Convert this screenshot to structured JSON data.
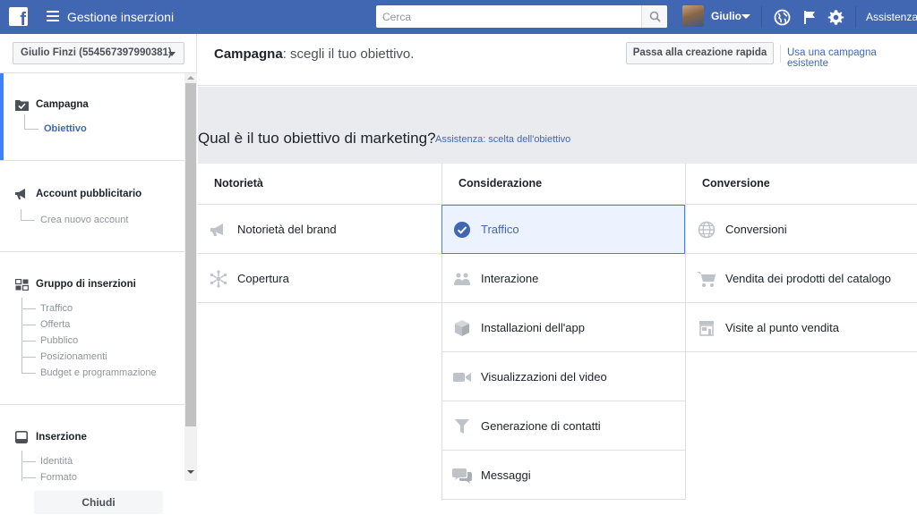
{
  "topbar": {
    "app_title": "Gestione inserzioni",
    "search_placeholder": "Cerca",
    "user_name": "Giulio",
    "help_label": "Assistenza",
    "brand_color": "#4267b2"
  },
  "sidebar": {
    "account_label": "Giulio Finzi (554567397990381)",
    "sections": [
      {
        "title": "Campagna",
        "icon": "campaign-folder-icon",
        "items": [
          "Obiettivo"
        ]
      },
      {
        "title": "Account pubblicitario",
        "icon": "megaphone-icon",
        "items": [
          "Crea nuovo account"
        ]
      },
      {
        "title": "Gruppo di inserzioni",
        "icon": "grid-icon",
        "items": [
          "Traffico",
          "Offerta",
          "Pubblico",
          "Posizionamenti",
          "Budget e programmazione"
        ]
      },
      {
        "title": "Inserzione",
        "icon": "ad-preview-icon",
        "items": [
          "Identità",
          "Formato"
        ]
      }
    ],
    "close_label": "Chiudi"
  },
  "header": {
    "title_bold": "Campagna",
    "title_rest": ": scegli il tuo obiettivo.",
    "quick_create_label": "Passa alla creazione rapida",
    "existing_campaign_link": "Usa una campagna esistente"
  },
  "objective": {
    "question": "Qual è il tuo obiettivo di marketing?",
    "help_link": "Assistenza: scelta dell'obiettivo",
    "columns": [
      {
        "title": "Notorietà",
        "options": [
          {
            "label": "Notorietà del brand",
            "icon": "megaphone-icon"
          },
          {
            "label": "Copertura",
            "icon": "reach-icon"
          }
        ]
      },
      {
        "title": "Considerazione",
        "options": [
          {
            "label": "Traffico",
            "icon": "check-circle-icon",
            "selected": true
          },
          {
            "label": "Interazione",
            "icon": "people-icon"
          },
          {
            "label": "Installazioni dell'app",
            "icon": "cube-icon"
          },
          {
            "label": "Visualizzazioni del video",
            "icon": "video-camera-icon"
          },
          {
            "label": "Generazione di contatti",
            "icon": "funnel-icon"
          },
          {
            "label": "Messaggi",
            "icon": "chat-bubbles-icon"
          }
        ]
      },
      {
        "title": "Conversione",
        "options": [
          {
            "label": "Conversioni",
            "icon": "globe-icon"
          },
          {
            "label": "Vendita dei prodotti del catalogo",
            "icon": "shopping-cart-icon"
          },
          {
            "label": "Visite al punto vendita",
            "icon": "store-icon"
          }
        ]
      }
    ]
  }
}
